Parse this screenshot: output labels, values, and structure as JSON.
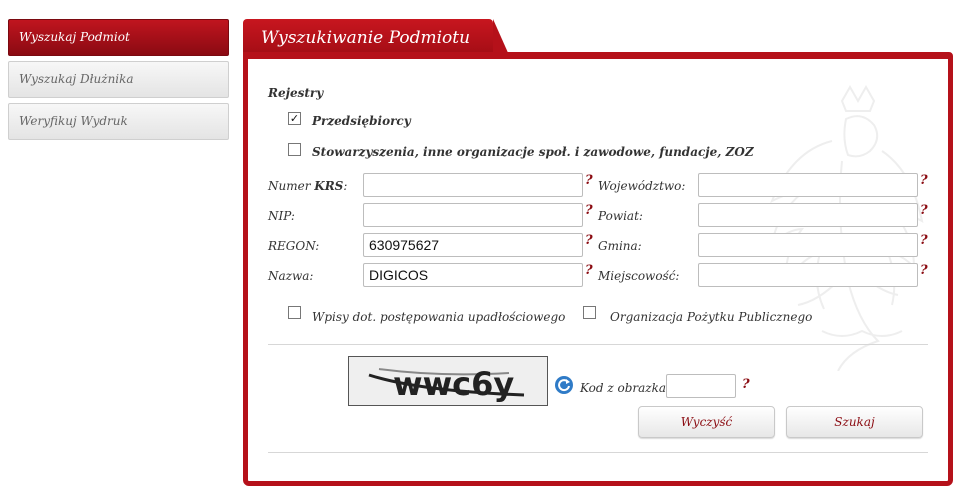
{
  "sidebar": {
    "items": [
      {
        "label": "Wyszukaj Podmiot",
        "active": true
      },
      {
        "label": "Wyszukaj Dłużnika",
        "active": false
      },
      {
        "label": "Weryfikuj Wydruk",
        "active": false
      }
    ]
  },
  "panel": {
    "title": "Wyszukiwanie Podmiotu",
    "registers_heading": "Rejestry",
    "register_options": [
      {
        "label": "Przedsiębiorcy",
        "checked": true
      },
      {
        "label": "Stowarzyszenia, inne organizacje społ. i zawodowe, fundacje, ZOZ",
        "checked": false
      }
    ],
    "fields_left": [
      {
        "label_prefix": "Numer ",
        "label_bold": "KRS",
        "label_suffix": ":",
        "value": ""
      },
      {
        "label_prefix": "NIP:",
        "label_bold": "",
        "label_suffix": "",
        "value": ""
      },
      {
        "label_prefix": "REGON:",
        "label_bold": "",
        "label_suffix": "",
        "value": "630975627"
      },
      {
        "label_prefix": "Nazwa:",
        "label_bold": "",
        "label_suffix": "",
        "value": "DIGICOS"
      }
    ],
    "fields_right": [
      {
        "label": "Województwo:",
        "value": ""
      },
      {
        "label": "Powiat:",
        "value": ""
      },
      {
        "label": "Gmina:",
        "value": ""
      },
      {
        "label": "Miejscowość:",
        "value": ""
      }
    ],
    "help_mark": "?",
    "extra_options": [
      {
        "label": "Wpisy dot. postępowania upadłościowego",
        "checked": false
      },
      {
        "label": "Organizacja Pożytku Publicznego",
        "checked": false
      }
    ],
    "captcha": {
      "text": "wwc6y",
      "code_label": "Kod z obrazka:",
      "code_value": ""
    },
    "buttons": {
      "clear": "Wyczyść",
      "search": "Szukaj"
    }
  },
  "colors": {
    "accent": "#b5111a",
    "help": "#8b0c12"
  }
}
